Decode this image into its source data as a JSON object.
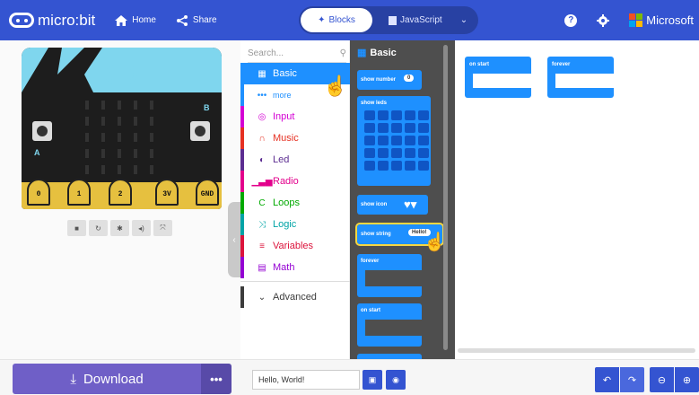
{
  "header": {
    "app_name": "micro:bit",
    "home_label": "Home",
    "share_label": "Share",
    "blocks_label": "Blocks",
    "javascript_label": "JavaScript",
    "brand": "Microsoft",
    "accent_color": "#3454d1"
  },
  "simulator": {
    "pins": [
      "0",
      "1",
      "2",
      "3V",
      "GND"
    ],
    "button_a": "A",
    "button_b": "B"
  },
  "toolbox": {
    "search_placeholder": "Search...",
    "categories": [
      {
        "label": "Basic",
        "color": "#1e90ff",
        "icon": "grid-icon"
      },
      {
        "label": "more",
        "color": "#1e90ff",
        "icon": "dots-icon"
      },
      {
        "label": "Input",
        "color": "#d400d4",
        "icon": "target-icon"
      },
      {
        "label": "Music",
        "color": "#e63022",
        "icon": "headphones-icon"
      },
      {
        "label": "Led",
        "color": "#5c2d91",
        "icon": "toggle-icon"
      },
      {
        "label": "Radio",
        "color": "#e3008c",
        "icon": "signal-icon"
      },
      {
        "label": "Loops",
        "color": "#00aa00",
        "icon": "loop-icon"
      },
      {
        "label": "Logic",
        "color": "#00a4a6",
        "icon": "shuffle-icon"
      },
      {
        "label": "Variables",
        "color": "#dc143c",
        "icon": "list-icon"
      },
      {
        "label": "Math",
        "color": "#9400d3",
        "icon": "calculator-icon"
      },
      {
        "label": "Advanced",
        "color": "#3c3c3c",
        "icon": "chevron-down-icon"
      }
    ]
  },
  "flyout": {
    "title": "Basic",
    "blocks": {
      "show_number": "show number",
      "show_number_value": "0",
      "show_leds": "show leds",
      "show_icon": "show icon",
      "show_string": "show string",
      "show_string_value": "Hello!",
      "forever": "forever",
      "on_start": "on start"
    }
  },
  "workspace": {
    "on_start": "on start",
    "forever": "forever"
  },
  "footer": {
    "download_label": "Download",
    "more_label": "•••",
    "project_name": "Hello, World!"
  }
}
